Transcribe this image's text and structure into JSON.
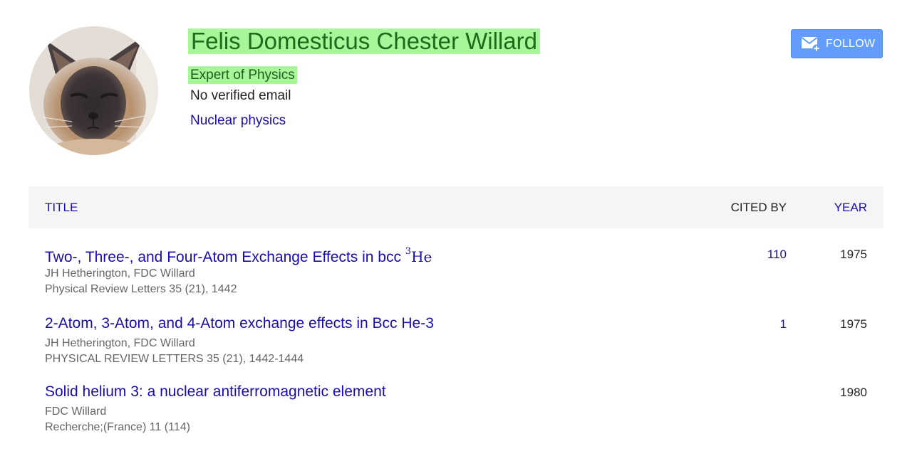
{
  "profile": {
    "name": "Felis Domesticus Chester Willard",
    "affiliation": "Expert of Physics",
    "email_status": "No verified email",
    "interest": "Nuclear physics",
    "highlight_color": "#a8f59a"
  },
  "follow": {
    "label": "FOLLOW",
    "icon": "mail-plus-icon",
    "color": "#4d90fe"
  },
  "table": {
    "headers": {
      "title": "TITLE",
      "cited_by": "CITED BY",
      "year": "YEAR"
    },
    "rows": [
      {
        "title_prefix": "Two-, Three-, and Four-Atom Exchange Effects in bcc ",
        "title_sup": "3",
        "title_suffix": "He",
        "authors": "JH Hetherington, FDC Willard",
        "venue": "Physical Review Letters 35 (21), 1442",
        "cited_by": "110",
        "year": "1975"
      },
      {
        "title": "2-Atom, 3-Atom, and 4-Atom exchange effects in Bcc He-3",
        "authors": "JH Hetherington, FDC Willard",
        "venue": "PHYSICAL REVIEW LETTERS 35 (21), 1442-1444",
        "cited_by": "1",
        "year": "1975"
      },
      {
        "title": "Solid helium 3: a nuclear antiferromagnetic element",
        "authors": "FDC Willard",
        "venue": "Recherche;(France) 11 (114)",
        "cited_by": "",
        "year": "1980"
      }
    ]
  },
  "colors": {
    "link": "#1a0dab",
    "meta": "#666666",
    "header_bg": "#f5f5f5"
  }
}
